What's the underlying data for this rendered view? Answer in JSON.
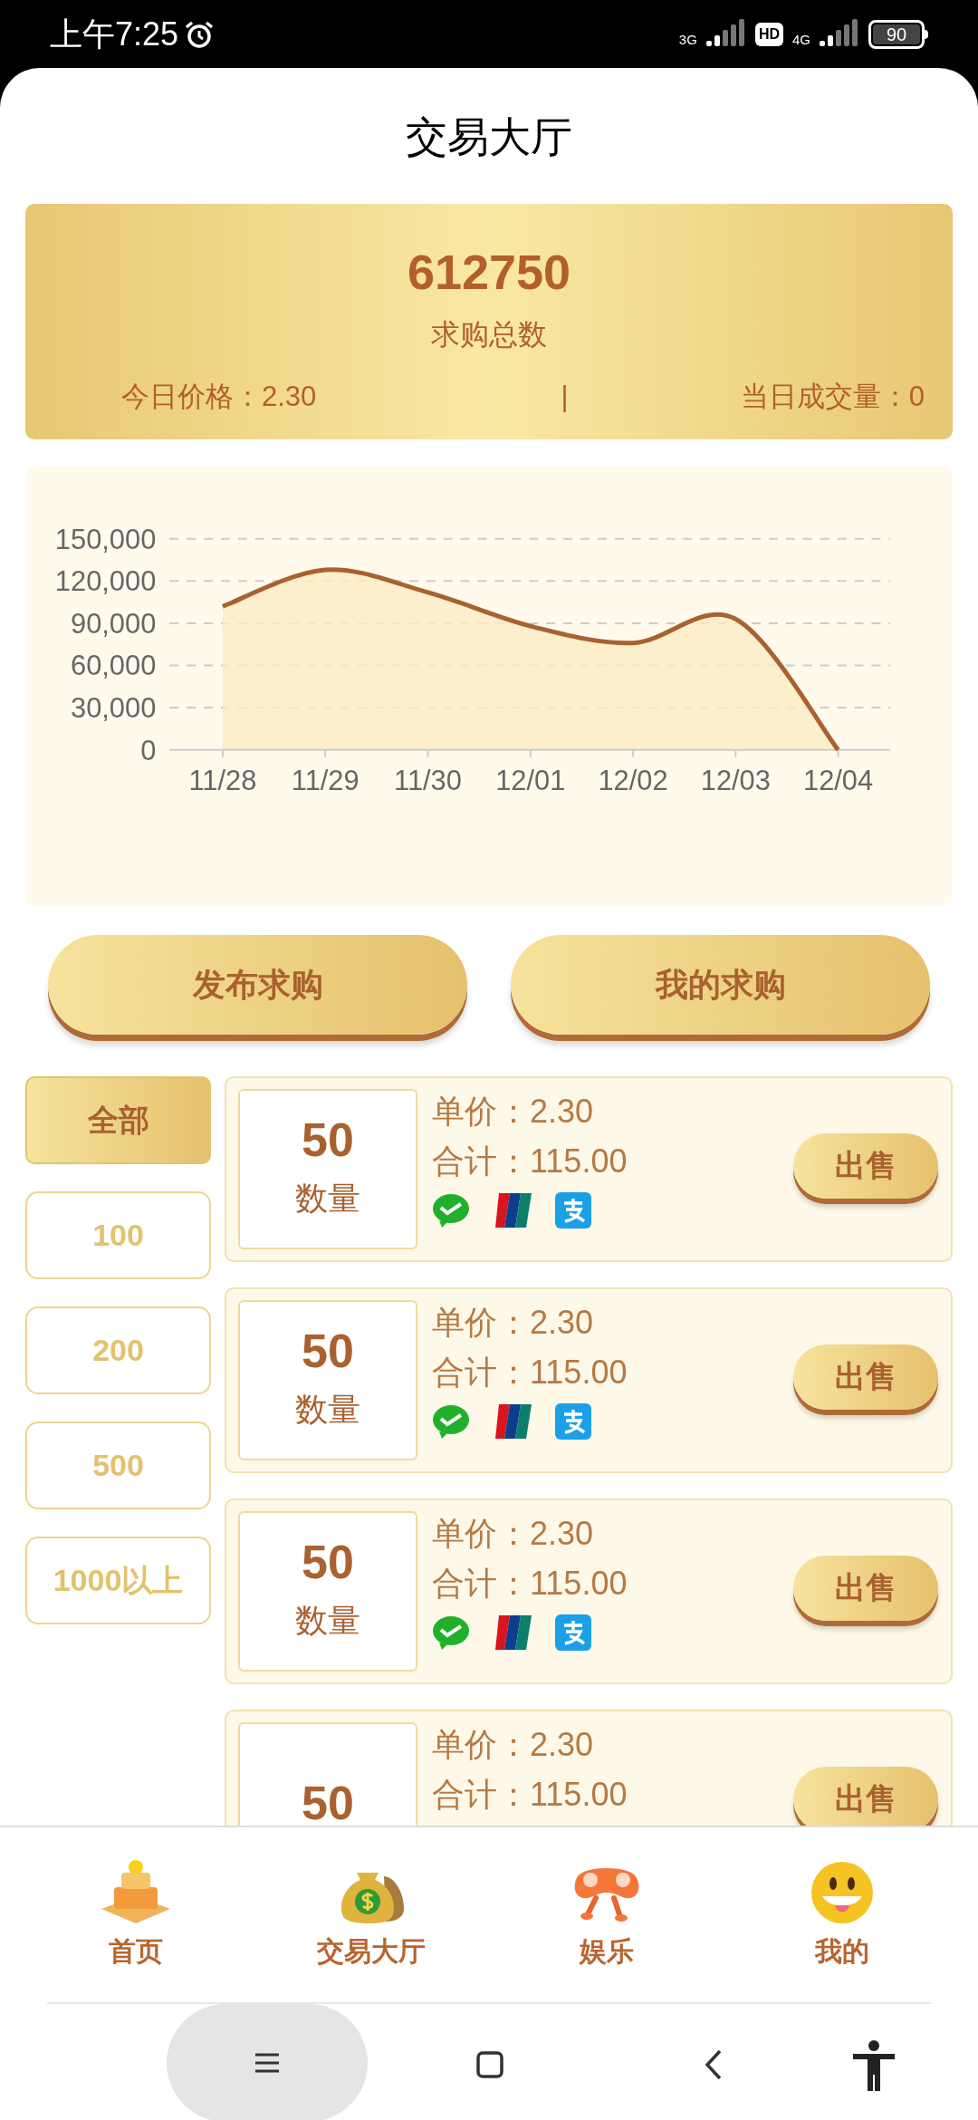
{
  "status_bar": {
    "time": "上午7:25",
    "network_1": "3G",
    "hd": "HD",
    "network_2": "4G",
    "battery": "90"
  },
  "title": "交易大厅",
  "summary": {
    "total": "612750",
    "total_label": "求购总数",
    "price": "今日价格：2.30",
    "separator": "|",
    "volume": "当日成交量：0"
  },
  "chart": {
    "chart_data": {
      "type": "area",
      "categories": [
        "11/28",
        "11/29",
        "11/30",
        "12/01",
        "12/02",
        "12/03",
        "12/04"
      ],
      "grid": true,
      "series": [
        {
          "color": "#a9612f",
          "values": [
            102000,
            128000,
            112000,
            88000,
            76000,
            93000,
            0
          ]
        }
      ],
      "ylim": [
        0,
        150000
      ],
      "yticks": [
        {
          "value": 0,
          "label": "0"
        },
        {
          "value": 30000,
          "label": "30,000"
        },
        {
          "value": 60000,
          "label": "60,000"
        },
        {
          "value": 90000,
          "label": "90,000"
        },
        {
          "value": 120000,
          "label": "120,000"
        },
        {
          "value": 150000,
          "label": "150,000"
        }
      ]
    }
  },
  "actions": [
    "发布求购",
    "我的求购"
  ],
  "filters": [
    {
      "label": "全部",
      "selected": true
    },
    {
      "label": "100",
      "selected": false
    },
    {
      "label": "200",
      "selected": false
    },
    {
      "label": "500",
      "selected": false
    },
    {
      "label": "1000以上",
      "selected": false
    }
  ],
  "orders": [
    {
      "quantity": "50",
      "quantity_label": "数量",
      "unit_price": "单价：2.30",
      "total": "合计：115.00",
      "payments": [
        {
          "kind": "wechat"
        },
        {
          "kind": "unionpay"
        },
        {
          "kind": "alipay"
        }
      ],
      "action": "出售"
    },
    {
      "quantity": "50",
      "quantity_label": "数量",
      "unit_price": "单价：2.30",
      "total": "合计：115.00",
      "payments": [
        {
          "kind": "wechat"
        },
        {
          "kind": "unionpay"
        },
        {
          "kind": "alipay"
        }
      ],
      "action": "出售"
    },
    {
      "quantity": "50",
      "quantity_label": "数量",
      "unit_price": "单价：2.30",
      "total": "合计：115.00",
      "payments": [
        {
          "kind": "wechat"
        },
        {
          "kind": "unionpay"
        },
        {
          "kind": "alipay"
        }
      ],
      "action": "出售"
    },
    {
      "quantity": "50",
      "unit_price": "单价：2.30",
      "total": "合计：115.00",
      "action": "出售"
    }
  ],
  "bottom_nav": [
    {
      "label": "首页",
      "kind": "home"
    },
    {
      "label": "交易大厅",
      "kind": "trade"
    },
    {
      "label": "娱乐",
      "kind": "fun"
    },
    {
      "label": "我的",
      "kind": "me"
    }
  ]
}
